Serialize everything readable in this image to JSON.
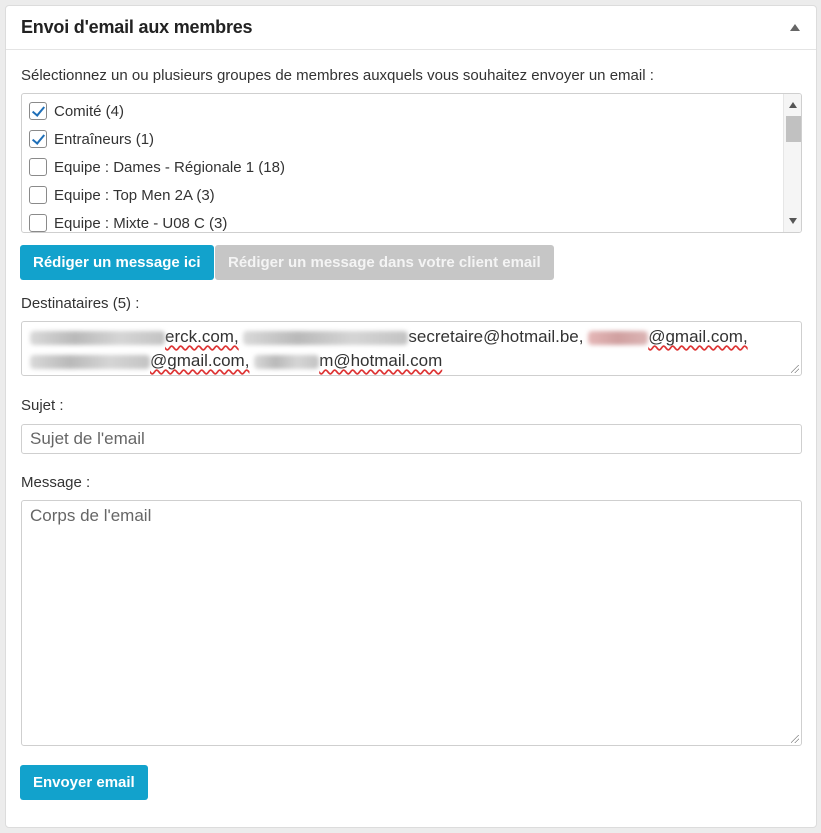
{
  "panel": {
    "title": "Envoi d'email aux membres",
    "collapse_icon": "caret-up-icon"
  },
  "groups": {
    "instruction": "Sélectionnez un ou plusieurs groupes de membres auxquels vous souhaitez envoyer un email :",
    "items": [
      {
        "label": "Comité (4)",
        "checked": true
      },
      {
        "label": "Entraîneurs (1)",
        "checked": true
      },
      {
        "label": "Equipe : Dames - Régionale 1 (18)",
        "checked": false
      },
      {
        "label": "Equipe : Top Men 2A (3)",
        "checked": false
      },
      {
        "label": "Equipe : Mixte - U08 C (3)",
        "checked": false
      }
    ]
  },
  "buttons": {
    "compose_here": "Rédiger un message ici",
    "compose_client": "Rédiger un message dans votre client email",
    "send": "Envoyer email"
  },
  "recipients": {
    "label": "Destinataires (5) :",
    "line1": {
      "part1": "erck.com,",
      "part2": "secretaire@hotmail.be,",
      "part3": "@gmail.com,"
    },
    "line2": {
      "part1": "@gmail.com,",
      "part2": "m@hotmail.com"
    }
  },
  "subject": {
    "label": "Sujet :",
    "placeholder": "Sujet de l'email"
  },
  "message": {
    "label": "Message :",
    "placeholder": "Corps de l'email"
  },
  "colors": {
    "primary": "#12a2cc",
    "disabled": "#c6c6c6",
    "check": "#1f6fb8"
  }
}
